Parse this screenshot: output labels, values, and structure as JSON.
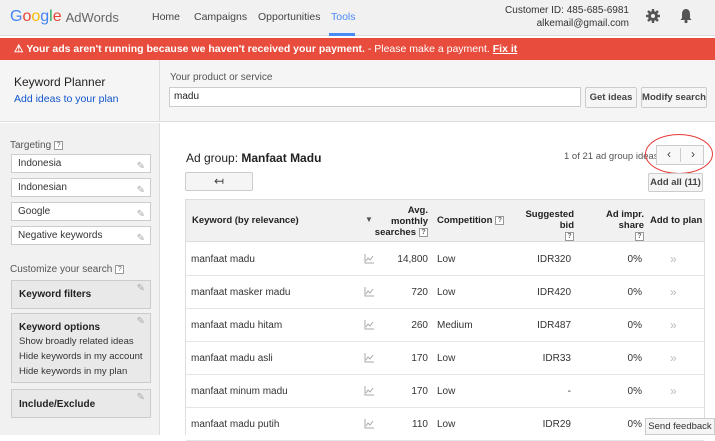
{
  "header": {
    "logo_google": "Google",
    "logo_adwords": "AdWords",
    "nav": [
      "Home",
      "Campaigns",
      "Opportunities",
      "Tools"
    ],
    "active_nav": "Tools",
    "customer_id": "Customer ID: 485-685-6981",
    "email": "alkemail@gmail.com"
  },
  "alert": {
    "bold_text": "Your ads aren't running because we haven't received your payment.",
    "text": " - Please make a payment.",
    "link": "Fix it"
  },
  "planner": {
    "title": "Keyword Planner",
    "subtitle": "Add ideas to your plan",
    "product_label": "Your product or service",
    "product_value": "madu",
    "get_ideas": "Get ideas",
    "modify_search": "Modify search"
  },
  "sidebar": {
    "targeting_label": "Targeting",
    "targeting": [
      "Indonesia",
      "Indonesian",
      "Google",
      "Negative keywords"
    ],
    "customize_label": "Customize your search",
    "keyword_filters": "Keyword filters",
    "keyword_options_title": "Keyword options",
    "keyword_options": [
      "Show broadly related ideas",
      "Hide keywords in my account",
      "Hide keywords in my plan"
    ],
    "include_exclude": "Include/Exclude"
  },
  "main": {
    "ad_group_prefix": "Ad group:",
    "ad_group_name": "Manfaat Madu",
    "pager_text": "1 of 21 ad group ideas",
    "back_symbol": "↤",
    "add_all": "Add all (11)",
    "columns": {
      "keyword": "Keyword (by relevance)",
      "avg": "Avg. monthly searches",
      "competition": "Competition",
      "bid": "Suggested bid",
      "impr": "Ad impr. share",
      "add": "Add to plan"
    },
    "rows": [
      {
        "keyword": "manfaat madu",
        "avg": "14,800",
        "competition": "Low",
        "bid": "IDR320",
        "impr": "0%"
      },
      {
        "keyword": "manfaat masker madu",
        "avg": "720",
        "competition": "Low",
        "bid": "IDR420",
        "impr": "0%"
      },
      {
        "keyword": "manfaat madu hitam",
        "avg": "260",
        "competition": "Medium",
        "bid": "IDR487",
        "impr": "0%"
      },
      {
        "keyword": "manfaat madu asli",
        "avg": "170",
        "competition": "Low",
        "bid": "IDR33",
        "impr": "0%"
      },
      {
        "keyword": "manfaat minum madu",
        "avg": "170",
        "competition": "Low",
        "bid": "-",
        "impr": "0%"
      },
      {
        "keyword": "manfaat madu putih",
        "avg": "110",
        "competition": "Low",
        "bid": "IDR29",
        "impr": "0%"
      }
    ]
  },
  "feedback": "Send feedback",
  "colors": {
    "accent": "#4a8af4",
    "alert": "#e74c3c",
    "link": "#1155cc"
  }
}
